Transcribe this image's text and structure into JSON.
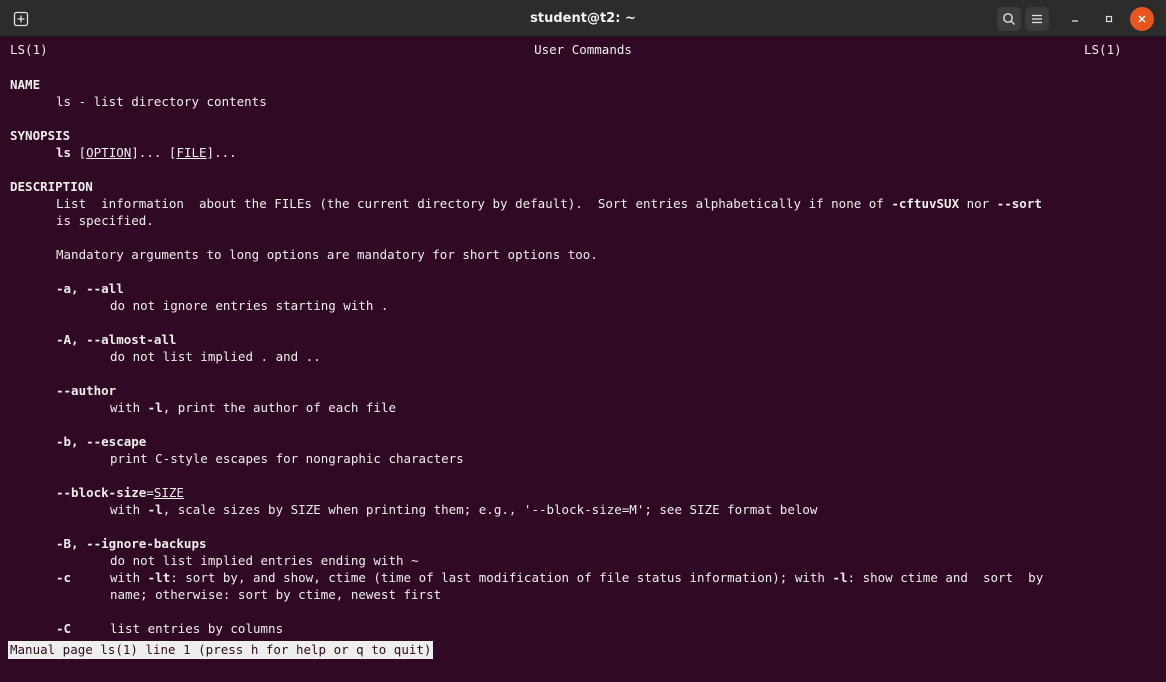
{
  "window": {
    "title": "student@t2: ~",
    "buttons": {
      "new_tab_icon": "new-tab-icon",
      "search_icon": "search-icon",
      "menu_icon": "hamburger-menu-icon",
      "minimize": "–",
      "maximize": "▫",
      "close": "✕"
    },
    "colors": {
      "background": "#300a24",
      "titlebar": "#2c2c2c",
      "close": "#e9541f",
      "text": "#eeeeec"
    }
  },
  "man": {
    "header_left": "LS(1)",
    "header_center": "User Commands",
    "header_right": "LS(1)",
    "name_heading": "NAME",
    "name_text": "ls - list directory contents",
    "synopsis_heading": "SYNOPSIS",
    "synopsis_cmd": "ls",
    "synopsis_sp1": " ",
    "synopsis_lb1": "[",
    "synopsis_option": "OPTION",
    "synopsis_rb1": "]... [",
    "synopsis_file": "FILE",
    "synopsis_rb2": "]...",
    "description_heading": "DESCRIPTION",
    "desc1_a": "List  information  about the FILEs (the current directory by default).  Sort entries alphabetically if none of ",
    "desc1_b": "-cftuvSUX",
    "desc1_c": " nor ",
    "desc1_d": "--sort",
    "desc2": "is specified.",
    "desc3": "Mandatory arguments to long options are mandatory for short options too.",
    "opt_a": "-a, --all",
    "opt_a_desc": "do not ignore entries starting with .",
    "opt_A": "-A, --almost-all",
    "opt_A_desc": "do not list implied . and ..",
    "opt_author": "--author",
    "opt_author_desc_a": "with ",
    "opt_author_desc_b": "-l",
    "opt_author_desc_c": ", print the author of each file",
    "opt_b": "-b, --escape",
    "opt_b_desc": "print C-style escapes for nongraphic characters",
    "opt_bs_a": "--block-size",
    "opt_bs_b": "=",
    "opt_bs_c": "SIZE",
    "opt_bs_desc_a": "with ",
    "opt_bs_desc_b": "-l",
    "opt_bs_desc_c": ", scale sizes by SIZE when printing them; e.g., '--block-size=M'; see SIZE format below",
    "opt_B": "-B, --ignore-backups",
    "opt_B_desc": "do not list implied entries ending with ~",
    "opt_c": "-c",
    "opt_c_desc1_a": "with ",
    "opt_c_desc1_b": "-lt",
    "opt_c_desc1_c": ": sort by, and show, ctime (time of last modification of file status information); with ",
    "opt_c_desc1_d": "-l",
    "opt_c_desc1_e": ": show ctime and  sort  by",
    "opt_c_desc2": "name; otherwise: sort by ctime, newest first",
    "opt_C": "-C",
    "opt_C_desc": "list entries by columns"
  },
  "status": "Manual page ls(1) line 1 (press h for help or q to quit)"
}
